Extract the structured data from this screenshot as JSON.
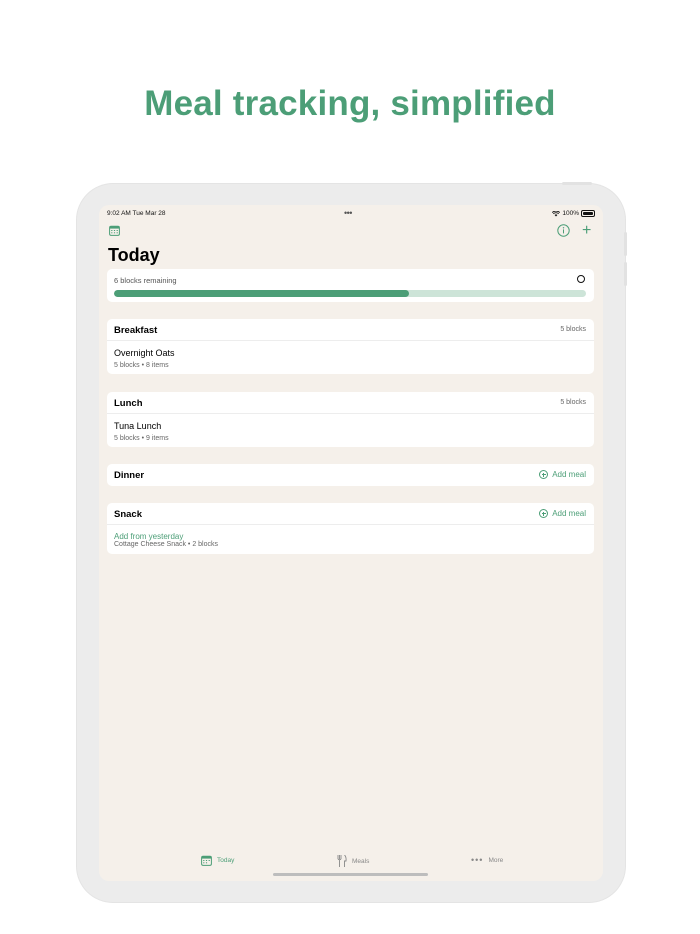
{
  "headline": "Meal tracking, simplified",
  "status_bar": {
    "time": "9:02 AM   Tue Mar 28",
    "battery": "100%"
  },
  "header": {
    "title": "Today",
    "calendar_icon": "calendar-icon",
    "info_icon": "info-icon",
    "plus_label": "+"
  },
  "progress": {
    "remaining_label": "6 blocks remaining",
    "fraction": 0.625
  },
  "meals": {
    "breakfast": {
      "name": "Breakfast",
      "blocks": "5 blocks",
      "item_name": "Overnight Oats",
      "item_sub": "5 blocks • 8 items"
    },
    "lunch": {
      "name": "Lunch",
      "blocks": "5 blocks",
      "item_name": "Tuna Lunch",
      "item_sub": "5 blocks • 9 items"
    },
    "dinner": {
      "name": "Dinner",
      "add_label": "Add meal"
    },
    "snack": {
      "name": "Snack",
      "add_label": "Add meal",
      "suggestion": "Add from yesterday",
      "suggestion_sub": "Cottage Cheese Snack • 2 blocks"
    }
  },
  "tabs": [
    {
      "label": "Today",
      "icon": "calendar-icon",
      "active": true
    },
    {
      "label": "Meals",
      "icon": "fork-knife-icon",
      "active": false
    },
    {
      "label": "More",
      "icon": "more-dots-icon",
      "active": false
    }
  ],
  "colors": {
    "accent": "#4c9e77",
    "background": "#f5f0ea",
    "track": "#cde4d8"
  }
}
